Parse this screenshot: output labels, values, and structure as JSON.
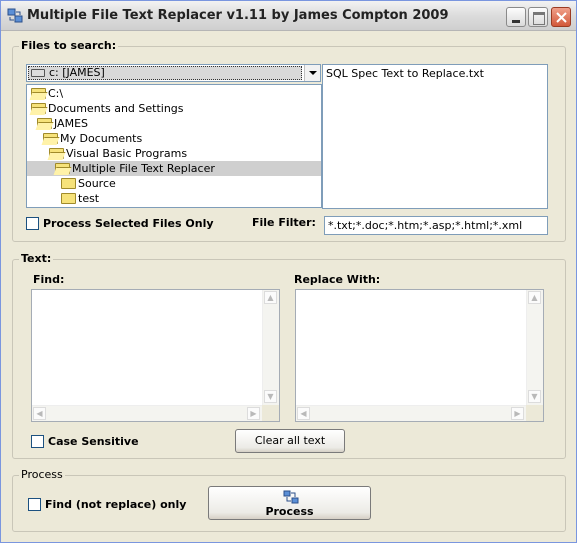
{
  "window": {
    "title": "Multiple File Text Replacer v1.11 by James Compton 2009"
  },
  "files_group": {
    "label": "Files to search:",
    "drive": "c: [JAMES]",
    "dirs": [
      {
        "label": "C:\\",
        "indent": 0,
        "selected": false
      },
      {
        "label": "Documents and Settings",
        "indent": 0,
        "selected": false
      },
      {
        "label": "JAMES",
        "indent": 1,
        "selected": false
      },
      {
        "label": "My Documents",
        "indent": 2,
        "selected": false
      },
      {
        "label": "Visual Basic Programs",
        "indent": 3,
        "selected": false
      },
      {
        "label": "Multiple File Text Replacer",
        "indent": 4,
        "selected": true
      },
      {
        "label": "Source",
        "indent": 5,
        "selected": false
      },
      {
        "label": "test",
        "indent": 5,
        "selected": false
      }
    ],
    "files": [
      "SQL Spec Text to Replace.txt"
    ],
    "process_selected_label": "Process Selected Files Only",
    "process_selected_checked": false,
    "file_filter_label": "File Filter:",
    "file_filter_value": "*.txt;*.doc;*.htm;*.asp;*.html;*.xml"
  },
  "text_group": {
    "label": "Text:",
    "find_label": "Find:",
    "find_value": "",
    "replace_label": "Replace With:",
    "replace_value": "",
    "case_sensitive_label": "Case Sensitive",
    "case_sensitive_checked": false,
    "clear_button": "Clear all text"
  },
  "process_group": {
    "label": "Process",
    "find_only_label": "Find (not replace) only",
    "find_only_checked": false,
    "process_button": "Process"
  }
}
